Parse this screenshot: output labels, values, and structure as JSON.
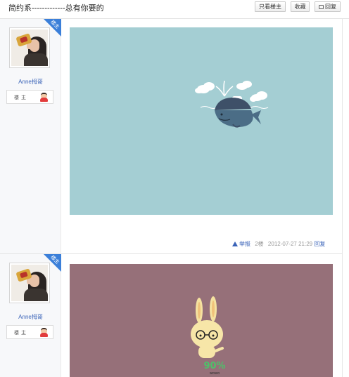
{
  "header": {
    "title": "简约系-------------总有你要的",
    "buttons": {
      "only_owner": "只看楼主",
      "favorite": "收藏",
      "reply": "回复"
    }
  },
  "posts": [
    {
      "corner_tag": "楼主",
      "username": "Anne拇哥",
      "badge_label": "楼主",
      "image": {
        "background": "#a4ced3",
        "subject": "whale-with-cloud-illustration"
      },
      "meta": {
        "report": "举报",
        "floor": "2楼",
        "datetime": "2012-07-27 21:29",
        "reply": "回复"
      }
    },
    {
      "corner_tag": "楼主",
      "username": "Anne拇哥",
      "badge_label": "楼主",
      "image": {
        "background": "#967079",
        "subject": "bunny-with-glasses-illustration",
        "caption": "90%",
        "sub_caption": "wowo"
      }
    }
  ],
  "colors": {
    "link": "#3a63b8",
    "corner_tag": "#3b7fd9",
    "sidebar": "#f7f8fa"
  }
}
